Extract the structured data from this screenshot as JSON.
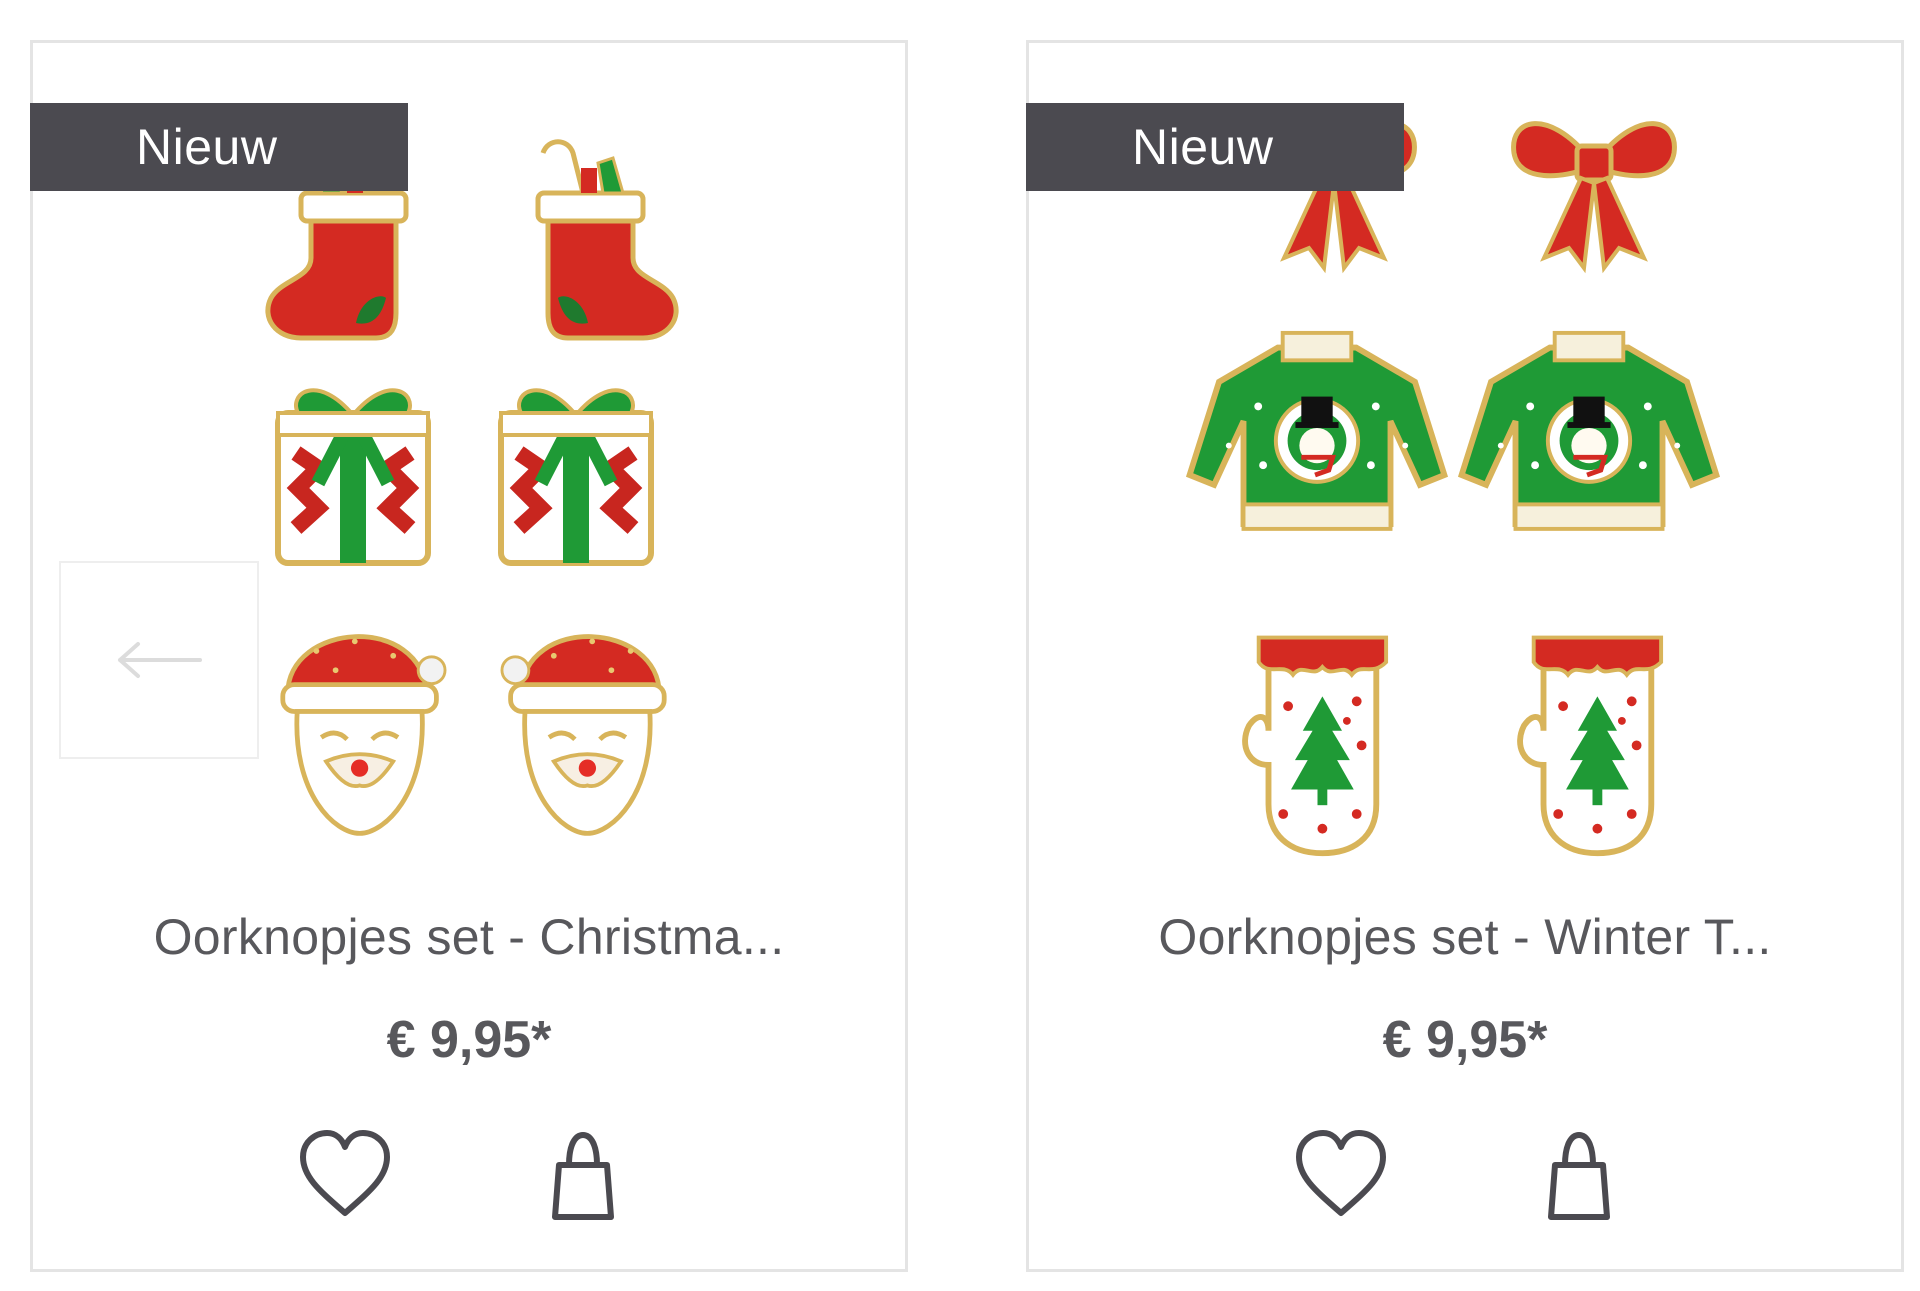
{
  "products": [
    {
      "badge": "Nieuw",
      "title": "Oorknopjes set - Christma...",
      "price": "€ 9,95*",
      "image": "christmas-stud-earrings-set",
      "icons": [
        "heart-icon",
        "shopping-bag-icon",
        "arrow-left-icon"
      ]
    },
    {
      "badge": "Nieuw",
      "title": "Oorknopjes set - Winter T...",
      "price": "€ 9,95*",
      "image": "winter-stud-earrings-set",
      "icons": [
        "heart-icon",
        "shopping-bag-icon"
      ]
    }
  ],
  "colors": {
    "badge_bg": "#4b4a50",
    "text": "#58585c",
    "border": "#e4e4e4",
    "red": "#d42a22",
    "green": "#1f9a36",
    "gold": "#d8b45a"
  }
}
